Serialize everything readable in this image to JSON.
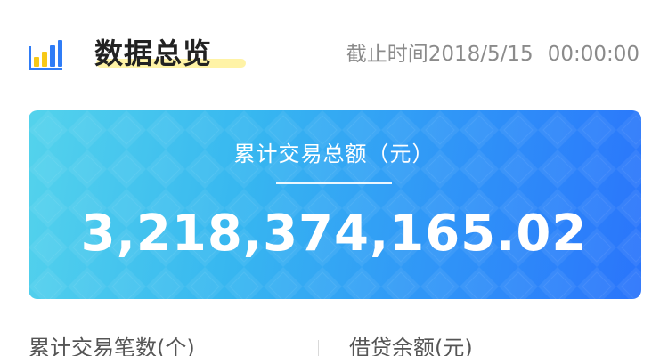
{
  "header": {
    "icon": "bar-chart-icon",
    "title": "数据总览",
    "deadline_label": "截止时间",
    "deadline_date": "2018/5/15",
    "deadline_time": "00:00:00"
  },
  "summary_card": {
    "label": "累计交易总额（元）",
    "amount": "3,218,374,165.02"
  },
  "stats": [
    {
      "label": "累计交易笔数(个)"
    },
    {
      "label": "借贷余额(元)"
    }
  ],
  "colors": {
    "card_gradient_start": "#54d3ec",
    "card_gradient_end": "#2a74fb",
    "title_highlight": "#fff3a6",
    "icon_yellow": "#f7c816",
    "icon_blue": "#2f7cf6"
  }
}
